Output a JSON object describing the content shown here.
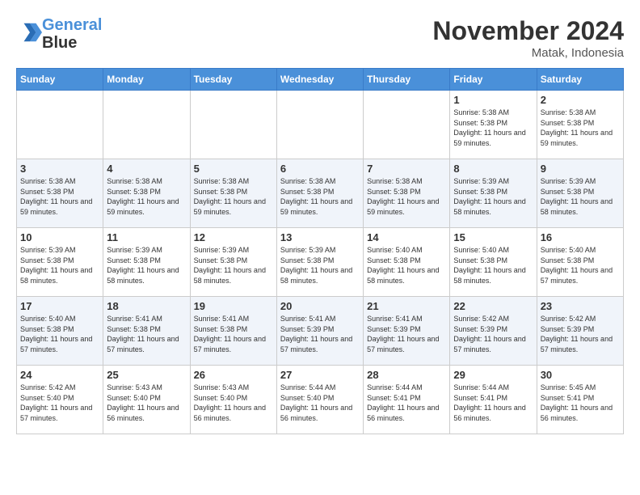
{
  "header": {
    "logo_line1": "General",
    "logo_line2": "Blue",
    "month": "November 2024",
    "location": "Matak, Indonesia"
  },
  "weekdays": [
    "Sunday",
    "Monday",
    "Tuesday",
    "Wednesday",
    "Thursday",
    "Friday",
    "Saturday"
  ],
  "weeks": [
    [
      {
        "day": "",
        "info": ""
      },
      {
        "day": "",
        "info": ""
      },
      {
        "day": "",
        "info": ""
      },
      {
        "day": "",
        "info": ""
      },
      {
        "day": "",
        "info": ""
      },
      {
        "day": "1",
        "info": "Sunrise: 5:38 AM\nSunset: 5:38 PM\nDaylight: 11 hours and 59 minutes."
      },
      {
        "day": "2",
        "info": "Sunrise: 5:38 AM\nSunset: 5:38 PM\nDaylight: 11 hours and 59 minutes."
      }
    ],
    [
      {
        "day": "3",
        "info": "Sunrise: 5:38 AM\nSunset: 5:38 PM\nDaylight: 11 hours and 59 minutes."
      },
      {
        "day": "4",
        "info": "Sunrise: 5:38 AM\nSunset: 5:38 PM\nDaylight: 11 hours and 59 minutes."
      },
      {
        "day": "5",
        "info": "Sunrise: 5:38 AM\nSunset: 5:38 PM\nDaylight: 11 hours and 59 minutes."
      },
      {
        "day": "6",
        "info": "Sunrise: 5:38 AM\nSunset: 5:38 PM\nDaylight: 11 hours and 59 minutes."
      },
      {
        "day": "7",
        "info": "Sunrise: 5:38 AM\nSunset: 5:38 PM\nDaylight: 11 hours and 59 minutes."
      },
      {
        "day": "8",
        "info": "Sunrise: 5:39 AM\nSunset: 5:38 PM\nDaylight: 11 hours and 58 minutes."
      },
      {
        "day": "9",
        "info": "Sunrise: 5:39 AM\nSunset: 5:38 PM\nDaylight: 11 hours and 58 minutes."
      }
    ],
    [
      {
        "day": "10",
        "info": "Sunrise: 5:39 AM\nSunset: 5:38 PM\nDaylight: 11 hours and 58 minutes."
      },
      {
        "day": "11",
        "info": "Sunrise: 5:39 AM\nSunset: 5:38 PM\nDaylight: 11 hours and 58 minutes."
      },
      {
        "day": "12",
        "info": "Sunrise: 5:39 AM\nSunset: 5:38 PM\nDaylight: 11 hours and 58 minutes."
      },
      {
        "day": "13",
        "info": "Sunrise: 5:39 AM\nSunset: 5:38 PM\nDaylight: 11 hours and 58 minutes."
      },
      {
        "day": "14",
        "info": "Sunrise: 5:40 AM\nSunset: 5:38 PM\nDaylight: 11 hours and 58 minutes."
      },
      {
        "day": "15",
        "info": "Sunrise: 5:40 AM\nSunset: 5:38 PM\nDaylight: 11 hours and 58 minutes."
      },
      {
        "day": "16",
        "info": "Sunrise: 5:40 AM\nSunset: 5:38 PM\nDaylight: 11 hours and 57 minutes."
      }
    ],
    [
      {
        "day": "17",
        "info": "Sunrise: 5:40 AM\nSunset: 5:38 PM\nDaylight: 11 hours and 57 minutes."
      },
      {
        "day": "18",
        "info": "Sunrise: 5:41 AM\nSunset: 5:38 PM\nDaylight: 11 hours and 57 minutes."
      },
      {
        "day": "19",
        "info": "Sunrise: 5:41 AM\nSunset: 5:38 PM\nDaylight: 11 hours and 57 minutes."
      },
      {
        "day": "20",
        "info": "Sunrise: 5:41 AM\nSunset: 5:39 PM\nDaylight: 11 hours and 57 minutes."
      },
      {
        "day": "21",
        "info": "Sunrise: 5:41 AM\nSunset: 5:39 PM\nDaylight: 11 hours and 57 minutes."
      },
      {
        "day": "22",
        "info": "Sunrise: 5:42 AM\nSunset: 5:39 PM\nDaylight: 11 hours and 57 minutes."
      },
      {
        "day": "23",
        "info": "Sunrise: 5:42 AM\nSunset: 5:39 PM\nDaylight: 11 hours and 57 minutes."
      }
    ],
    [
      {
        "day": "24",
        "info": "Sunrise: 5:42 AM\nSunset: 5:40 PM\nDaylight: 11 hours and 57 minutes."
      },
      {
        "day": "25",
        "info": "Sunrise: 5:43 AM\nSunset: 5:40 PM\nDaylight: 11 hours and 56 minutes."
      },
      {
        "day": "26",
        "info": "Sunrise: 5:43 AM\nSunset: 5:40 PM\nDaylight: 11 hours and 56 minutes."
      },
      {
        "day": "27",
        "info": "Sunrise: 5:44 AM\nSunset: 5:40 PM\nDaylight: 11 hours and 56 minutes."
      },
      {
        "day": "28",
        "info": "Sunrise: 5:44 AM\nSunset: 5:41 PM\nDaylight: 11 hours and 56 minutes."
      },
      {
        "day": "29",
        "info": "Sunrise: 5:44 AM\nSunset: 5:41 PM\nDaylight: 11 hours and 56 minutes."
      },
      {
        "day": "30",
        "info": "Sunrise: 5:45 AM\nSunset: 5:41 PM\nDaylight: 11 hours and 56 minutes."
      }
    ]
  ]
}
